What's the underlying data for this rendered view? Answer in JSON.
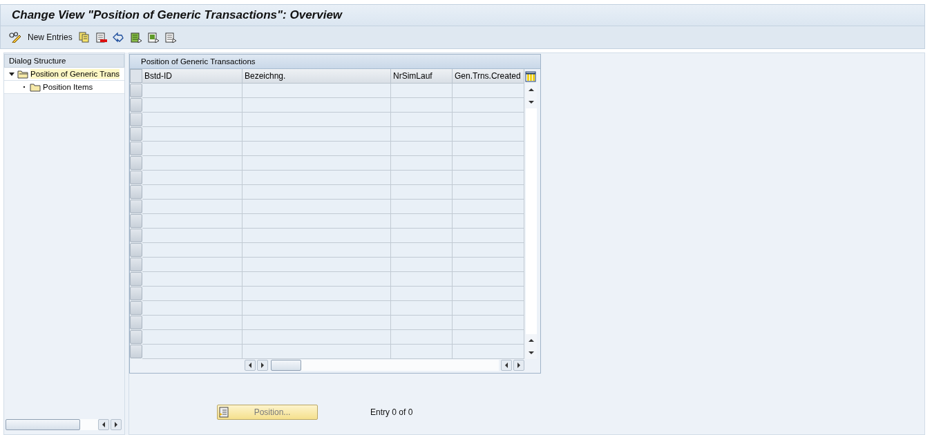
{
  "window": {
    "title": "Change View \"Position of Generic Transactions\": Overview"
  },
  "toolbar": {
    "new_entries": "New Entries"
  },
  "dialog_structure": {
    "title": "Dialog Structure",
    "items": [
      {
        "label": "Position of Generic Trans",
        "expanded": true,
        "selected": true,
        "children": [
          {
            "label": "Position Items",
            "selected": false
          }
        ]
      }
    ]
  },
  "table": {
    "title": "Position of Generic Transactions",
    "columns": [
      "Bstd-ID",
      "Bezeichng.",
      "NrSimLauf",
      "Gen.Trns.Created"
    ]
  },
  "footer": {
    "position_button": "Position...",
    "entry_info": "Entry 0 of 0"
  }
}
